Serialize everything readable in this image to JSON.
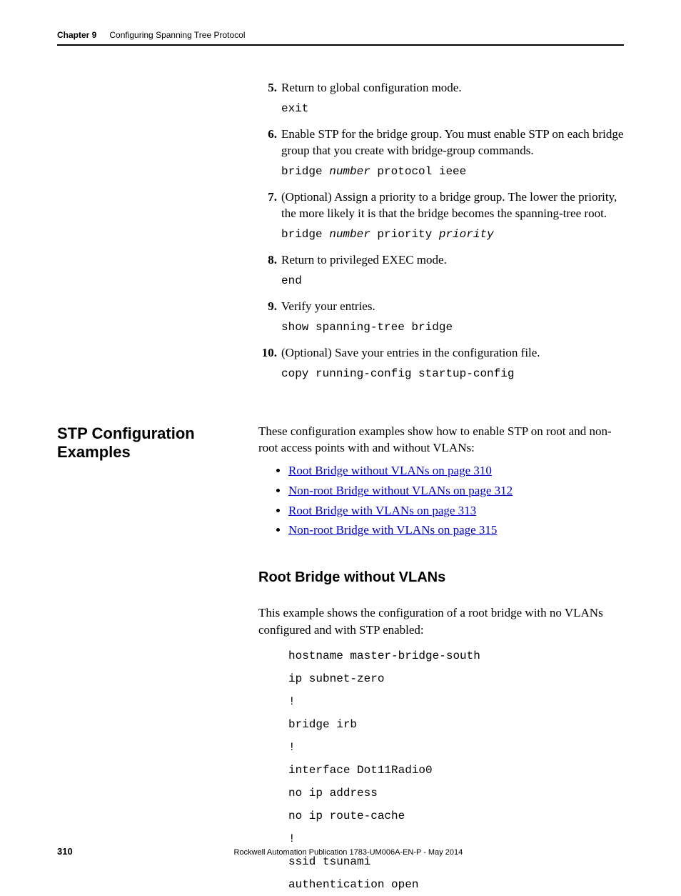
{
  "header": {
    "chapter": "Chapter 9",
    "title": "Configuring Spanning Tree Protocol"
  },
  "steps": {
    "s5": {
      "num": "5.",
      "text": "Return to global configuration mode.",
      "cmd_plain": "exit"
    },
    "s6": {
      "num": "6.",
      "text": "Enable STP for the bridge group. You must enable STP on each bridge group that you create with bridge-group commands.",
      "cmd_p1": "bridge ",
      "cmd_arg1": "number",
      "cmd_p2": " protocol ieee"
    },
    "s7": {
      "num": "7.",
      "text": "(Optional) Assign a priority to a bridge group. The lower the priority, the more likely it is that the bridge becomes the spanning-tree root.",
      "cmd_p1": "bridge ",
      "cmd_arg1": "number",
      "cmd_p2": " priority ",
      "cmd_arg2": "priority"
    },
    "s8": {
      "num": "8.",
      "text": "Return to privileged EXEC mode.",
      "cmd_plain": "end"
    },
    "s9": {
      "num": "9.",
      "text": "Verify your entries.",
      "cmd_plain": "show spanning-tree bridge"
    },
    "s10": {
      "num": "10.",
      "text": "(Optional) Save your entries in the configuration file.",
      "cmd_plain": "copy running-config startup-config"
    }
  },
  "section": {
    "label": "STP Configuration Examples",
    "intro": "These configuration examples show how to enable STP on root and non-root access points with and without VLANs:",
    "links": {
      "l1": "Root Bridge without VLANs on page 310",
      "l2": "Non-root Bridge without VLANs on page 312",
      "l3": "Root Bridge with VLANs on page 313",
      "l4": "Non-root Bridge with VLANs on page 315"
    },
    "sub_head": "Root Bridge without VLANs",
    "sub_intro": "This example shows the configuration of a root bridge with no VLANs configured and with STP enabled:",
    "code": "hostname master-bridge-south\nip subnet-zero\n!\nbridge irb\n!\ninterface Dot11Radio0\nno ip address\nno ip route-cache\n!\nssid tsunami\nauthentication open"
  },
  "footer": {
    "page": "310",
    "pub": "Rockwell Automation Publication 1783-UM006A-EN-P - May 2014"
  }
}
